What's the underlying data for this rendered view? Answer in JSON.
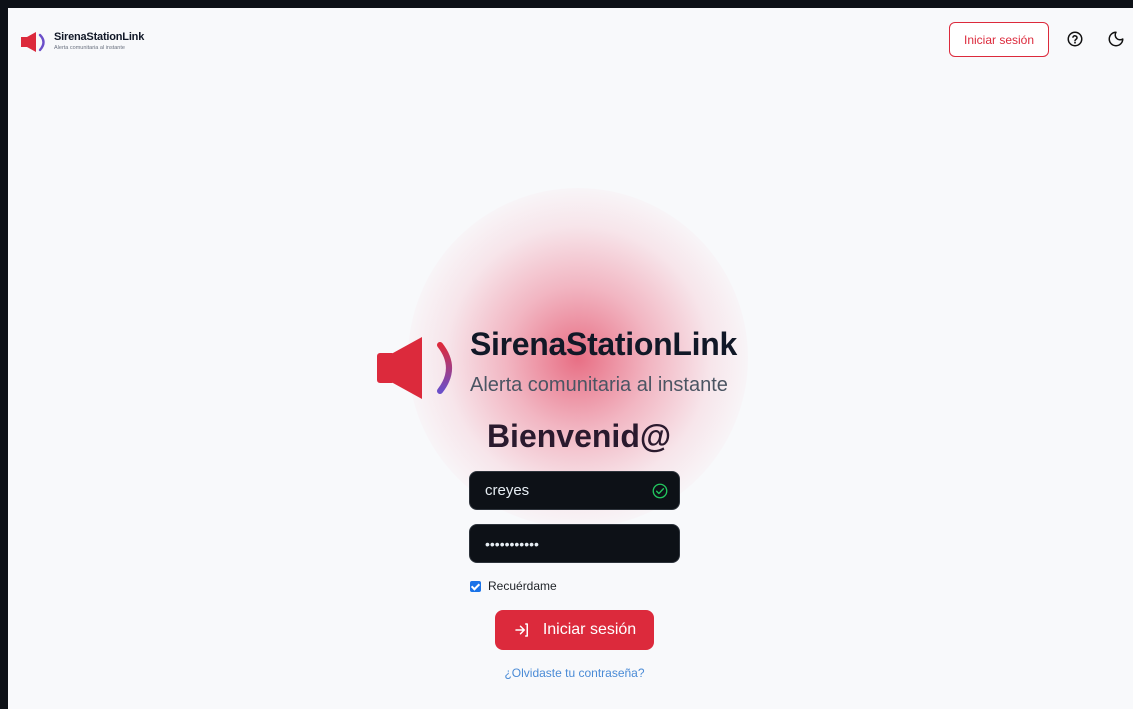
{
  "header": {
    "brand_title": "SirenaStationLink",
    "brand_subtitle": "Alerta comunitaria al instante",
    "login_label": "Iniciar sesión",
    "icons": [
      "help-circle-icon",
      "moon-icon"
    ]
  },
  "hero": {
    "title": "SirenaStationLink",
    "subtitle": "Alerta comunitaria al instante",
    "welcome": "Bienvenid@"
  },
  "form": {
    "username_value": "creyes",
    "password_value": "•••••••••••",
    "remember_label": "Recuérdame",
    "remember_checked": true,
    "submit_label": "Iniciar sesión",
    "forgot_label": "¿Olvidaste tu contraseña?"
  },
  "colors": {
    "accent": "#dc2a3c",
    "background": "#f8f9fb",
    "field_bg": "#0d1117",
    "valid": "#22c55e",
    "link": "#4a8bd6",
    "arc": "#6b4fc9"
  }
}
